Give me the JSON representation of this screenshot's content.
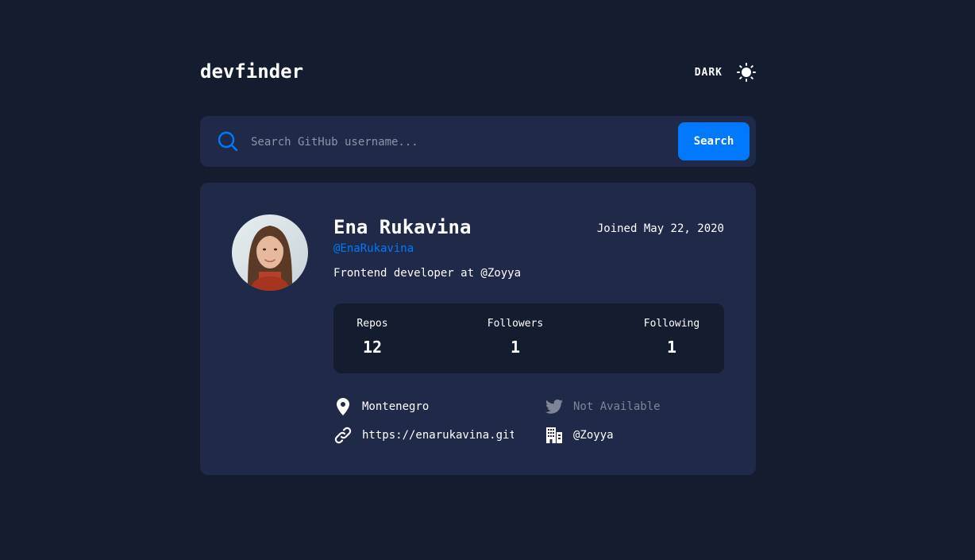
{
  "app": {
    "logo": "devfinder",
    "theme_label": "DARK",
    "theme_icon": "sun-icon"
  },
  "search": {
    "placeholder": "Search GitHub username...",
    "value": "",
    "button_label": "Search",
    "icon": "search-icon"
  },
  "profile": {
    "name": "Ena Rukavina",
    "login": "@EnaRukavina",
    "joined": "Joined May 22, 2020",
    "bio": "Frontend developer at @Zoyya",
    "stats": {
      "repos_label": "Repos",
      "repos": "12",
      "followers_label": "Followers",
      "followers": "1",
      "following_label": "Following",
      "following": "1"
    },
    "links": {
      "location": "Montenegro",
      "twitter": "Not Available",
      "blog": "https://enarukavina.git",
      "company": "@Zoyya"
    }
  },
  "colors": {
    "background": "#141c2f",
    "card": "#1e2a47",
    "accent": "#0079ff",
    "muted_text": "#7d8596"
  }
}
